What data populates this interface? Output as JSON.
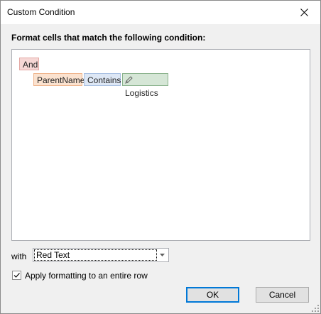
{
  "window": {
    "title": "Custom Condition"
  },
  "dialog": {
    "heading": "Format cells that match the following condition:",
    "condition": {
      "group_operator": "And",
      "field": "ParentName",
      "operator": "Contains",
      "value": "Logistics"
    },
    "with_label": "with",
    "format_combo": {
      "selected": "Red Text"
    },
    "apply_row": {
      "label": "Apply formatting to an entire row",
      "checked": true
    },
    "ok_label": "OK",
    "cancel_label": "Cancel"
  },
  "colors": {
    "accent": "#0078d7",
    "and_token": "#f6d7d5",
    "field_token": "#fbe2cf",
    "operator_token": "#dde7f5",
    "value_token": "#d5e6d6"
  },
  "icons": {
    "close": "close-icon",
    "value_edit": "pencil-icon",
    "dropdown": "chevron-down-icon",
    "checkbox": "checkmark-icon",
    "resize": "resize-grip-icon"
  }
}
